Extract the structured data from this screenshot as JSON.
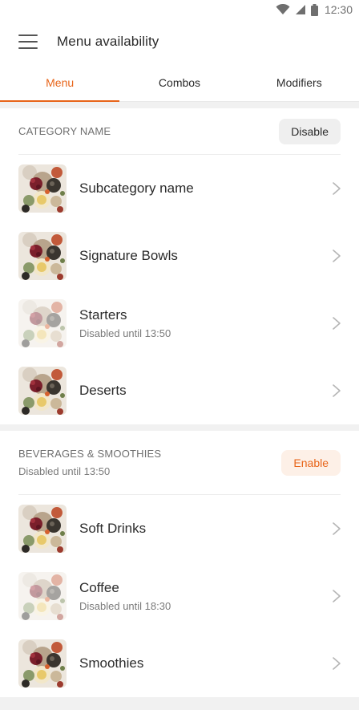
{
  "status_bar": {
    "time": "12:30",
    "icons": [
      "wifi-icon",
      "signal-icon",
      "battery-icon"
    ]
  },
  "app_bar": {
    "title": "Menu availability"
  },
  "tabs": [
    {
      "label": "Menu",
      "active": true
    },
    {
      "label": "Combos",
      "active": false
    },
    {
      "label": "Modifiers",
      "active": false
    }
  ],
  "sections": [
    {
      "title": "CATEGORY NAME",
      "subtitle": "",
      "action_label": "Disable",
      "items": [
        {
          "name": "Subcategory name",
          "status": ""
        },
        {
          "name": "Signature Bowls",
          "status": ""
        },
        {
          "name": "Starters",
          "status": "Disabled until 13:50"
        },
        {
          "name": "Deserts",
          "status": ""
        }
      ]
    },
    {
      "title": "BEVERAGES & SMOOTHIES",
      "subtitle": "Disabled until 13:50",
      "action_label": "Enable",
      "items": [
        {
          "name": "Soft Drinks",
          "status": ""
        },
        {
          "name": "Coffee",
          "status": "Disabled until 18:30"
        },
        {
          "name": "Smoothies",
          "status": ""
        }
      ]
    }
  ],
  "colors": {
    "accent": "#e8651a",
    "divider": "#ececec",
    "section_gap": "#f1f1f1"
  }
}
